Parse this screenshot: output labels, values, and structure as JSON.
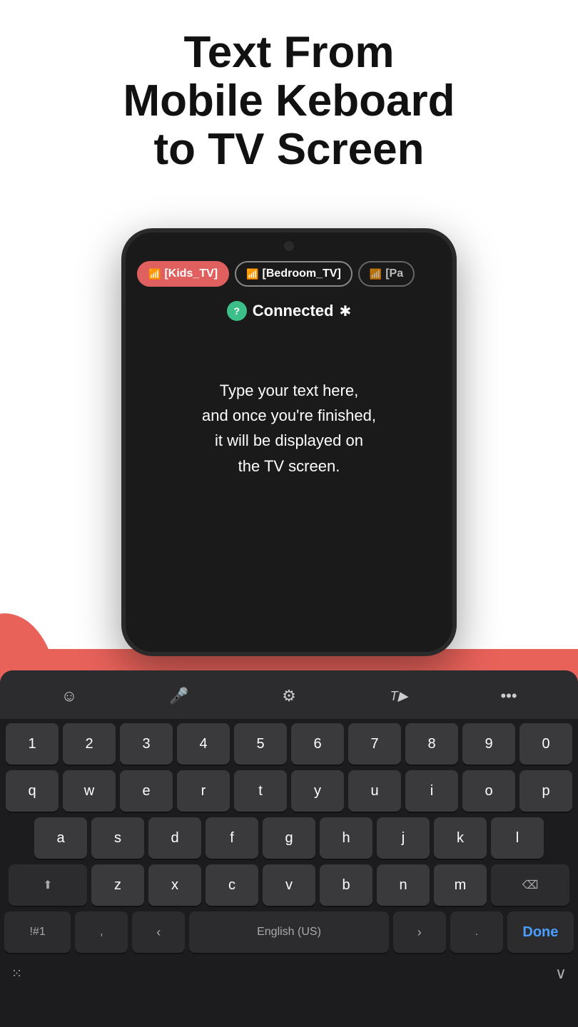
{
  "header": {
    "title": "Text From\nMobile Keboard\nto TV Screen"
  },
  "phone": {
    "tabs": [
      {
        "label": "[Kids_TV]",
        "active": true
      },
      {
        "label": "[Bedroom_TV]",
        "active": false
      },
      {
        "label": "[Pa",
        "active": false,
        "partial": true
      }
    ],
    "connected_label": "Connected",
    "body_text": "Type your text here,\nand once you're finished,\nit will be displayed on\nthe TV screen."
  },
  "keyboard": {
    "toolbar": {
      "emoji": "☺",
      "mic": "🎤",
      "settings": "⚙",
      "text_style": "𝒯",
      "more": "···"
    },
    "rows": {
      "numbers": [
        "1",
        "2",
        "3",
        "4",
        "5",
        "6",
        "7",
        "8",
        "9",
        "0"
      ],
      "row1": [
        "q",
        "w",
        "e",
        "r",
        "t",
        "y",
        "u",
        "i",
        "o",
        "p"
      ],
      "row2": [
        "a",
        "s",
        "d",
        "f",
        "g",
        "h",
        "j",
        "k",
        "l"
      ],
      "row3": [
        "z",
        "x",
        "c",
        "v",
        "b",
        "n",
        "m"
      ],
      "bottom": {
        "special": "!#1",
        "comma": ",",
        "lang": "English (US)",
        "period": ".",
        "done": "Done"
      }
    },
    "bottom_icons": {
      "grid": "⊞",
      "chevron": "⌄"
    }
  },
  "colors": {
    "pink": "#e8625a",
    "keyboard_bg": "#1c1c1e",
    "key_bg": "#3a3a3c",
    "active_tab": "#e06060",
    "connected_green": "#3dbf8a"
  }
}
